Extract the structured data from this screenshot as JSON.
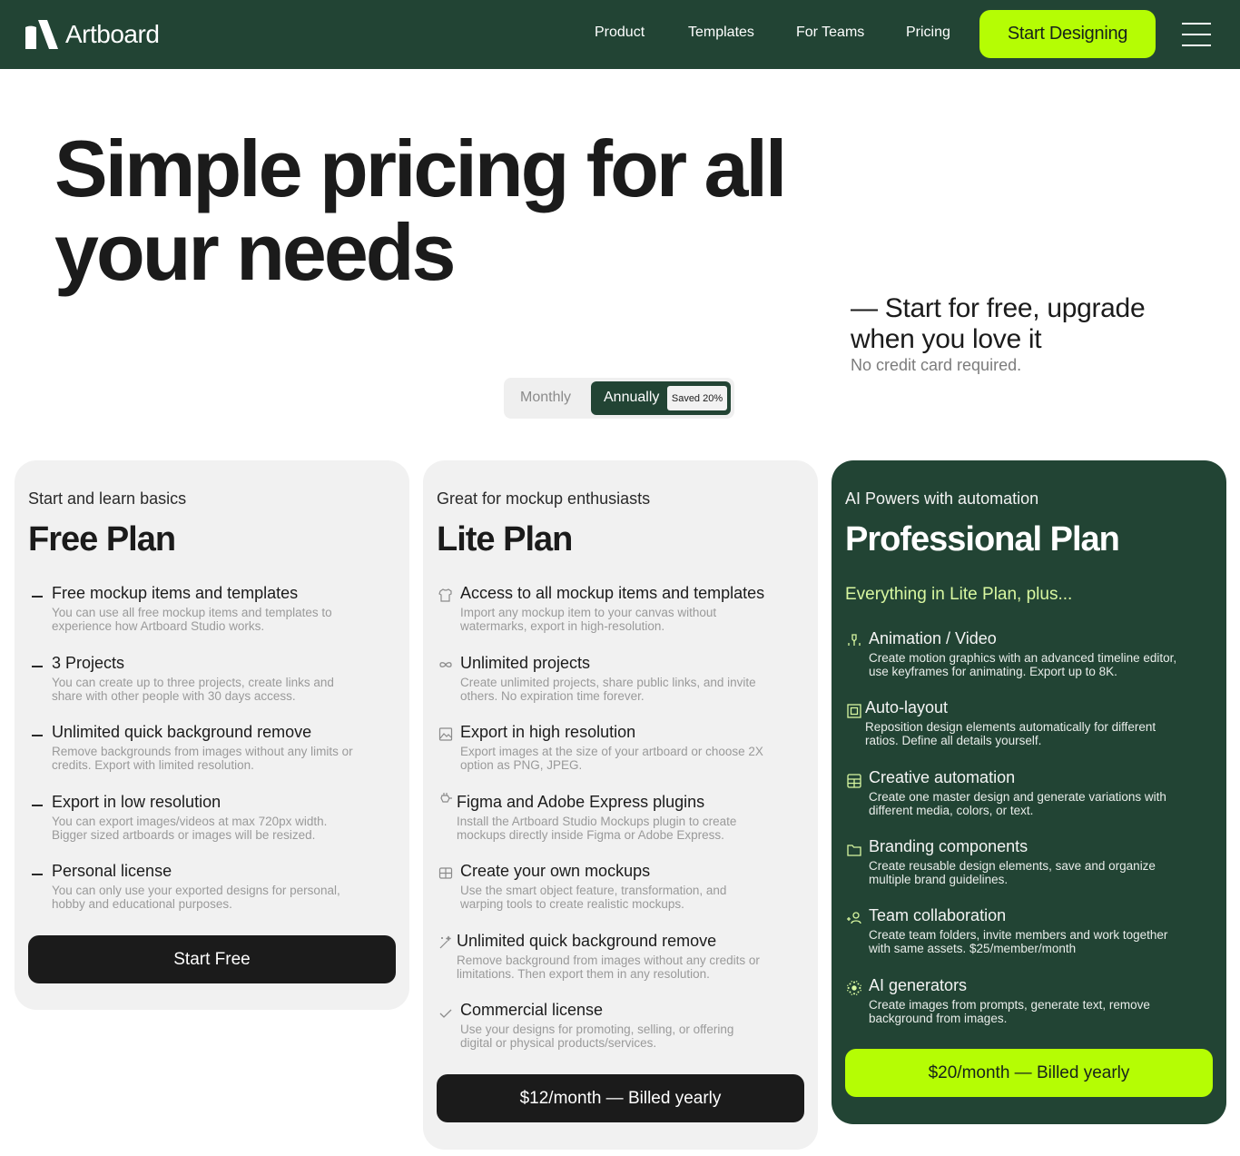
{
  "nav": {
    "brand": "Artboard",
    "links": [
      "Product",
      "Templates",
      "For Teams",
      "Pricing"
    ],
    "cta": "Start Designing",
    "menu_icon": "hamburger-menu-icon"
  },
  "hero": {
    "title": "Simple pricing for all your needs",
    "subtitle": "— Start for free, upgrade when you love it",
    "note": "No credit card required."
  },
  "billing_toggle": {
    "options": [
      "Monthly",
      "Annually"
    ],
    "selected": "Annually",
    "badge": "Saved 20%"
  },
  "plans": [
    {
      "tagline": "Start and learn basics",
      "name": "Free Plan",
      "features": [
        {
          "icon": "dash-icon",
          "title": "Free mockup items and templates",
          "desc": "You can use all free mockup items and templates to experience how Artboard Studio works."
        },
        {
          "icon": "dash-icon",
          "title": "3 Projects",
          "desc": "You can create up to three projects, create links and share with other people with 30 days access."
        },
        {
          "icon": "dash-icon",
          "title": "Unlimited quick background remove",
          "desc": "Remove backgrounds from images without any limits or credits. Export with limited resolution."
        },
        {
          "icon": "dash-icon",
          "title": "Export in low resolution",
          "desc": "You can export images/videos at max 720px width. Bigger sized artboards or images will be resized."
        },
        {
          "icon": "dash-icon",
          "title": "Personal license",
          "desc": "You can only use your exported designs for personal, hobby and educational purposes."
        }
      ],
      "button": "Start Free"
    },
    {
      "tagline": "Great for mockup enthusiasts",
      "name": "Lite Plan",
      "features": [
        {
          "icon": "tshirt-icon",
          "title": "Access to all mockup items and templates",
          "desc": "Import any mockup item to your canvas without watermarks, export in high-resolution."
        },
        {
          "icon": "infinity-icon",
          "title": "Unlimited projects",
          "desc": "Create unlimited projects, share public links, and invite others. No expiration time forever."
        },
        {
          "icon": "image-icon",
          "title": "Export in high resolution",
          "desc": "Export images at the size of your artboard or choose 2X option as PNG, JPEG."
        },
        {
          "icon": "plugin-icon",
          "title": "Figma and Adobe Express plugins",
          "desc": "Install the Artboard Studio Mockups plugin to create mockups directly inside Figma or Adobe Express."
        },
        {
          "icon": "cube-icon",
          "title": "Create your own mockups",
          "desc": "Use the smart object feature, transformation, and warping tools to create realistic mockups."
        },
        {
          "icon": "magic-wand-icon",
          "title": "Unlimited quick background remove",
          "desc": "Remove background from images without any credits or limitations. Then export them in any resolution."
        },
        {
          "icon": "check-icon",
          "title": "Commercial license",
          "desc": "Use your designs for promoting, selling, or offering digital or physical products/services."
        }
      ],
      "button": "$12/month — Billed yearly"
    },
    {
      "tagline": "AI Powers with automation",
      "name": "Professional Plan",
      "intro": "Everything in Lite Plan, plus...",
      "features": [
        {
          "icon": "keyframe-icon",
          "title": "Animation / Video",
          "desc": "Create motion graphics with an advanced timeline editor, use keyframes for animating. Export up to 8K."
        },
        {
          "icon": "auto-layout-icon",
          "title": "Auto-layout",
          "desc": "Reposition design elements automatically for different ratios. Define all details yourself."
        },
        {
          "icon": "grid-icon",
          "title": "Creative automation",
          "desc": "Create one master design and generate variations with different media, colors, or text."
        },
        {
          "icon": "folder-icon",
          "title": "Branding components",
          "desc": "Create reusable design elements, save and organize multiple brand guidelines."
        },
        {
          "icon": "add-user-icon",
          "title": "Team collaboration",
          "desc": "Create team folders, invite members and work together with same assets. $25/member/month"
        },
        {
          "icon": "ai-sparkle-icon",
          "title": "AI generators",
          "desc": "Create images from prompts, generate text, remove background from images."
        }
      ],
      "button": "$20/month — Billed yearly"
    }
  ],
  "colors": {
    "brand_dark_green": "#224434",
    "accent_lime": "#b5fd04",
    "card_gray": "#f1f1f1",
    "button_dark": "#1b1b1b",
    "pro_highlight": "#d8f7a0"
  }
}
